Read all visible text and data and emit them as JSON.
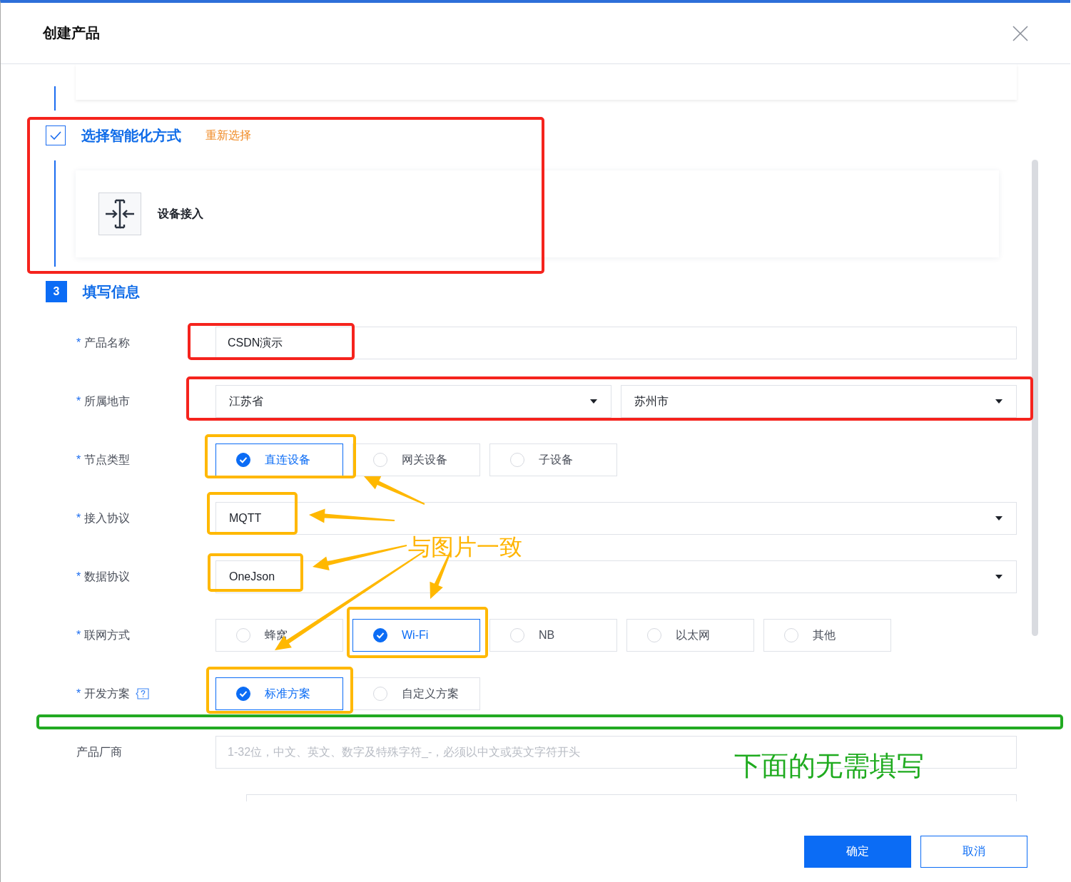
{
  "dialog": {
    "title": "创建产品"
  },
  "steps": [
    {
      "kind": "done",
      "title": "选择智能化方式",
      "action": "重新选择",
      "option": {
        "label": "设备接入"
      }
    },
    {
      "kind": "number",
      "number": "3",
      "title": "填写信息"
    }
  ],
  "form": {
    "rows": [
      {
        "kind": "text",
        "mark": "*",
        "label": "产品名称",
        "value": "CSDN演示"
      },
      {
        "kind": "selects",
        "mark": "*",
        "label": "所属地市",
        "values": [
          "江苏省",
          "苏州市"
        ]
      },
      {
        "kind": "radio",
        "mark": "*",
        "label": "节点类型",
        "options": [
          {
            "label": "直连设备",
            "selected": true
          },
          {
            "label": "网关设备",
            "selected": false
          },
          {
            "label": "子设备",
            "selected": false
          }
        ]
      },
      {
        "kind": "select",
        "mark": "*",
        "label": "接入协议",
        "value": "MQTT"
      },
      {
        "kind": "select",
        "mark": "*",
        "label": "数据协议",
        "value": "OneJson"
      },
      {
        "kind": "radio",
        "mark": "*",
        "label": "联网方式",
        "options": [
          {
            "label": "蜂窝",
            "selected": false
          },
          {
            "label": "Wi-Fi",
            "selected": true
          },
          {
            "label": "NB",
            "selected": false
          },
          {
            "label": "以太网",
            "selected": false
          },
          {
            "label": "其他",
            "selected": false
          }
        ]
      },
      {
        "kind": "radio",
        "mark": "*",
        "label": "开发方案",
        "help": true,
        "options": [
          {
            "label": "标准方案",
            "selected": true
          },
          {
            "label": "自定义方案",
            "selected": false
          }
        ]
      },
      {
        "kind": "text",
        "label": "产品厂商",
        "placeholder": "1-32位，中文、英文、数字及特殊字符_-，必须以中文或英文字符开头"
      }
    ]
  },
  "buttons": [
    {
      "label": "确定",
      "kind": "primary"
    },
    {
      "label": "取消",
      "kind": "secondary"
    }
  ],
  "annotations": [
    {
      "text": "与图片一致",
      "color": "#ffb400"
    },
    {
      "text": "下面的无需填写",
      "color": "#1fab1f"
    }
  ]
}
